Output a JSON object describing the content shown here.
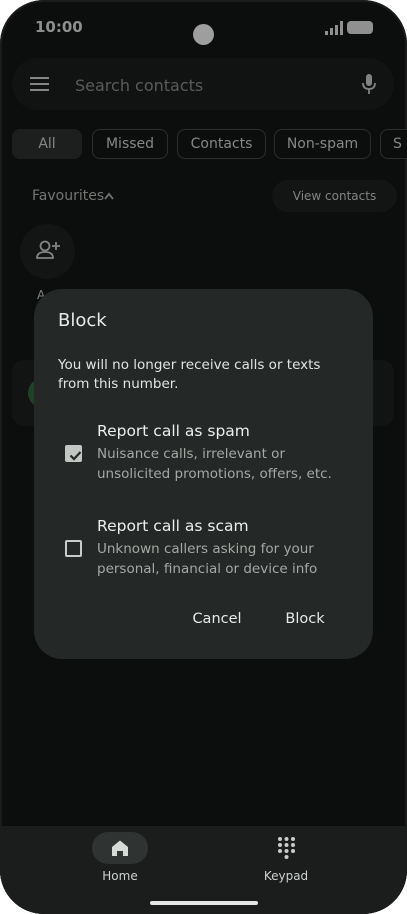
{
  "status_bar": {
    "time": "10:00"
  },
  "search": {
    "placeholder": "Search contacts"
  },
  "filter_chips": [
    {
      "label": "All",
      "selected": true
    },
    {
      "label": "Missed",
      "selected": false
    },
    {
      "label": "Contacts",
      "selected": false
    },
    {
      "label": "Non-spam",
      "selected": false
    },
    {
      "label": "S",
      "selected": false
    }
  ],
  "favourites": {
    "title": "Favourites",
    "view_contacts_label": "View contacts",
    "add_label": "A"
  },
  "dialog": {
    "title": "Block",
    "message": "You will no longer receive calls or texts from this number.",
    "options": [
      {
        "title": "Report call as spam",
        "description": "Nuisance calls, irrelevant or unsolicited promotions, offers, etc.",
        "checked": true
      },
      {
        "title": "Report call as scam",
        "description": "Unknown callers asking for your personal, financial or device info",
        "checked": false
      }
    ],
    "cancel_label": "Cancel",
    "confirm_label": "Block"
  },
  "bottom_nav": {
    "items": [
      {
        "label": "Home",
        "icon": "home-icon",
        "selected": true
      },
      {
        "label": "Keypad",
        "icon": "keypad-icon",
        "selected": false
      }
    ]
  },
  "colors": {
    "background": "#141615",
    "dialog": "#242826",
    "checkbox_checked": "#c3c7c4"
  }
}
